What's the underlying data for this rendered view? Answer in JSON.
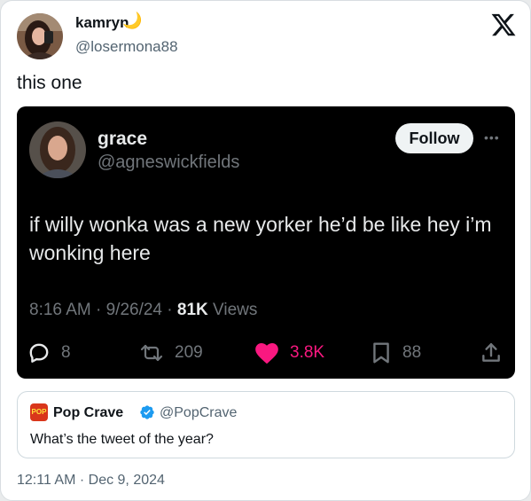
{
  "author": {
    "name": "kamryn",
    "emoji": "🌙",
    "handle": "@losermona88",
    "avatar_icon": "avatar-photo",
    "text": "this one"
  },
  "platform_logo": "x-logo",
  "embedded_tweet": {
    "name": "grace",
    "handle": "@agneswickfields",
    "follow_label": "Follow",
    "more_icon": "more-options-icon",
    "text": "if willy wonka was a new yorker he’d be like hey i’m wonking here",
    "time_date": "8:16 AM · 9/26/24 · ",
    "views_count": "81K",
    "views_label": " Views",
    "stats": {
      "replies": "8",
      "retweets": "209",
      "likes": "3.8K",
      "bookmarks": "88"
    },
    "colors": {
      "background": "#000000",
      "like": "#f91880"
    }
  },
  "quoted_tweet": {
    "logo_text": "POP",
    "name": "Pop Crave",
    "verified_icon": "verified-badge-icon",
    "handle": "@PopCrave",
    "text": "What’s the tweet of the year?"
  },
  "timestamp": "12:11 AM · Dec 9, 2024",
  "colors": {
    "secondary_text": "#536471",
    "verified": "#1d9bf0"
  }
}
